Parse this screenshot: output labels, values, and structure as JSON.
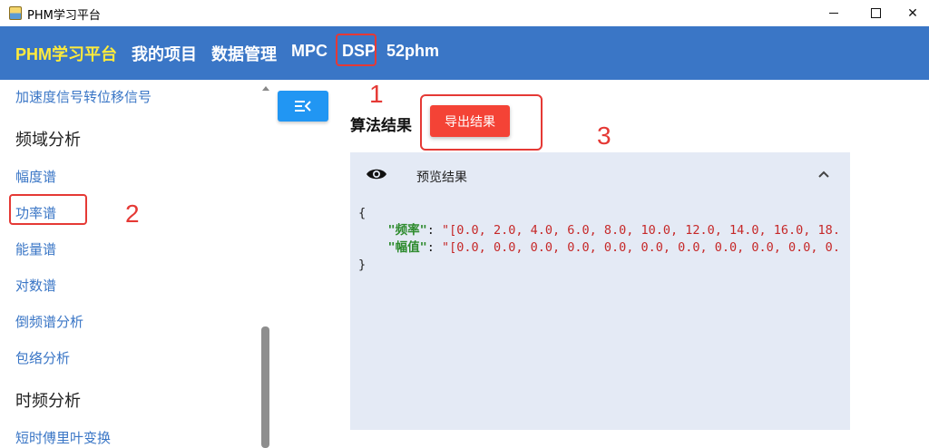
{
  "window": {
    "title": "PHM学习平台"
  },
  "appbar": {
    "brand": "PHM学习平台",
    "nav": [
      "我的项目",
      "数据管理",
      "MPC",
      "DSP",
      "52phm"
    ],
    "brand_color": "#ffeb3b",
    "background": "#3a76c6"
  },
  "sidebar": {
    "items": [
      {
        "label": "加速度信号转位移信号",
        "type": "link"
      },
      {
        "label": "频域分析",
        "type": "heading"
      },
      {
        "label": "幅度谱",
        "type": "link"
      },
      {
        "label": "功率谱",
        "type": "link"
      },
      {
        "label": "能量谱",
        "type": "link"
      },
      {
        "label": "对数谱",
        "type": "link"
      },
      {
        "label": "倒频谱分析",
        "type": "link"
      },
      {
        "label": "包络分析",
        "type": "link"
      },
      {
        "label": "时频分析",
        "type": "heading"
      },
      {
        "label": "短时傅里叶变换",
        "type": "link"
      }
    ]
  },
  "annotations": [
    "1",
    "2",
    "3"
  ],
  "main": {
    "section_title": "算法结果",
    "export_label": "导出结果",
    "panel_title": "预览结果",
    "json_preview": {
      "open": "{",
      "close": "}",
      "key1": "\"频率\"",
      "value1": "\"[0.0, 2.0, 4.0, 6.0, 8.0, 10.0, 12.0, 14.0, 16.0, 18.",
      "key2": "\"幅值\"",
      "value2": "\"[0.0, 0.0, 0.0, 0.0, 0.0, 0.0, 0.0, 0.0, 0.0, 0.0, 0."
    }
  },
  "colors": {
    "accent": "#2196f3",
    "danger": "#f44336",
    "highlight_box": "#e53935",
    "panel_bg": "#e4eaf5"
  }
}
